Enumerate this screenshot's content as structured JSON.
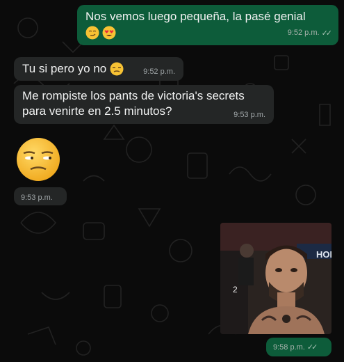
{
  "chat": {
    "messages": [
      {
        "direction": "outgoing",
        "text_line1": "Nos vemos luego pequeña, la pasé genial",
        "emojis": [
          "smirk-emoji",
          "heart-eyes-emoji"
        ],
        "time": "9:52 p.m.",
        "status": "read"
      },
      {
        "direction": "incoming",
        "text": "Tu si pero yo no",
        "emojis": [
          "unamused-emoji"
        ],
        "time": "9:52 p.m."
      },
      {
        "direction": "incoming",
        "text_line1": "Me rompiste los pants de victoria's secrets",
        "text_line2": "para venirte en 2.5 minutos?",
        "time": "9:53 p.m."
      },
      {
        "direction": "incoming",
        "type": "emoji",
        "emoji": "unamused-emoji",
        "time": "9:53 p.m."
      },
      {
        "direction": "outgoing",
        "type": "image",
        "image_label": "photo of a fighter in an arena",
        "overlay_text": "HON",
        "time": "9:58 p.m.",
        "status": "read"
      }
    ]
  },
  "colors": {
    "outgoing_bubble": "#0d5c3a",
    "incoming_bubble": "#242626",
    "background": "#0b0b0b",
    "read_ticks": "#a9c4b6"
  }
}
